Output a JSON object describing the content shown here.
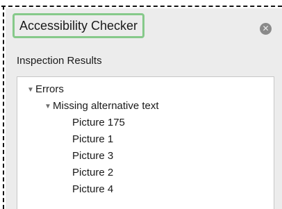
{
  "panel": {
    "title": "Accessibility Checker",
    "close_icon": "close-circle-icon",
    "section_label": "Inspection Results"
  },
  "tree": {
    "errors_label": "Errors",
    "errors_expanded": true,
    "missing_alt_label": "Missing alternative text",
    "missing_alt_expanded": true,
    "items": [
      {
        "label": "Picture 175"
      },
      {
        "label": "Picture 1"
      },
      {
        "label": "Picture 3"
      },
      {
        "label": "Picture 2"
      },
      {
        "label": "Picture 4"
      }
    ]
  },
  "colors": {
    "focus_ring": "#86c98a",
    "pane_background": "#ececec"
  }
}
